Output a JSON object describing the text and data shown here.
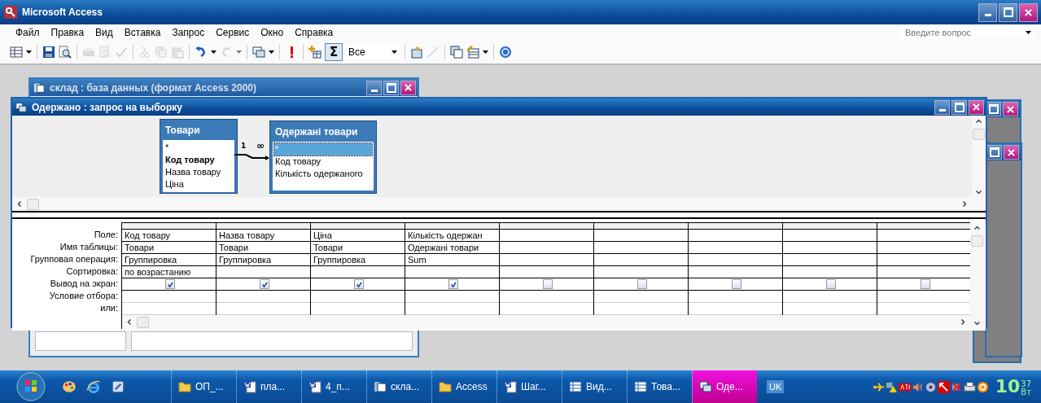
{
  "app": {
    "title": "Microsoft Access"
  },
  "menu": [
    {
      "label": "Файл"
    },
    {
      "label": "Правка"
    },
    {
      "label": "Вид"
    },
    {
      "label": "Вставка"
    },
    {
      "label": "Запрос"
    },
    {
      "label": "Сервис"
    },
    {
      "label": "Окно"
    },
    {
      "label": "Справка"
    }
  ],
  "help_box": {
    "placeholder": "Введите вопрос"
  },
  "toolbar": {
    "totals": {
      "label": "Σ",
      "pressed": true
    },
    "top_values": {
      "value": "Все"
    }
  },
  "db_window": {
    "title": "склад : база данных (формат Access 2000)"
  },
  "query_window": {
    "title": "Одержано : запрос на выборку",
    "tables": [
      {
        "name": "Товари",
        "fields": [
          {
            "name": "*",
            "key": false,
            "selected": false
          },
          {
            "name": "Код товару",
            "key": true,
            "selected": false
          },
          {
            "name": "Назва товару",
            "key": false,
            "selected": false
          },
          {
            "name": "Ціна",
            "key": false,
            "selected": false
          }
        ]
      },
      {
        "name": "Одержані товари",
        "fields": [
          {
            "name": "*",
            "key": false,
            "selected": true
          },
          {
            "name": "Код товару",
            "key": false,
            "selected": false
          },
          {
            "name": "Кількість одержаного",
            "key": false,
            "selected": false
          }
        ]
      }
    ],
    "relation": {
      "one": "1",
      "many": "∞"
    },
    "row_labels": [
      "Поле:",
      "Имя таблицы:",
      "Групповая операция:",
      "Сортировка:",
      "Вывод на экран:",
      "Условие отбора:",
      "или:"
    ],
    "columns": [
      {
        "field": "Код товару",
        "table": "Товари",
        "group": "Группировка",
        "sort": "по возрастанию",
        "show": true
      },
      {
        "field": "Назва товару",
        "table": "Товари",
        "group": "Группировка",
        "show": true
      },
      {
        "field": "Ціна",
        "table": "Товари",
        "group": "Группировка",
        "show": true
      },
      {
        "field": "Кількість одержан",
        "table": "Одержані товари",
        "group": "Sum",
        "show": true
      },
      {
        "show": false
      },
      {
        "show": false
      },
      {
        "show": false
      },
      {
        "show": false
      },
      {
        "show": false
      }
    ]
  },
  "taskbar": {
    "items": [
      {
        "label": "ОП_...",
        "kind": "folder",
        "selected": false
      },
      {
        "label": "пла...",
        "kind": "word",
        "selected": false
      },
      {
        "label": "4_п...",
        "kind": "word",
        "selected": false
      },
      {
        "label": "скла...",
        "kind": "db",
        "selected": false
      },
      {
        "label": "Access",
        "kind": "folder",
        "selected": false
      },
      {
        "label": "Шаг...",
        "kind": "word",
        "selected": false
      },
      {
        "label": "Вид...",
        "kind": "table",
        "selected": false
      },
      {
        "label": "Това...",
        "kind": "table",
        "selected": false
      },
      {
        "label": "Оде...",
        "kind": "query",
        "selected": true
      }
    ],
    "language": "UK",
    "clock": {
      "hour": "10",
      "minute": "37",
      "day": "Вт"
    }
  }
}
